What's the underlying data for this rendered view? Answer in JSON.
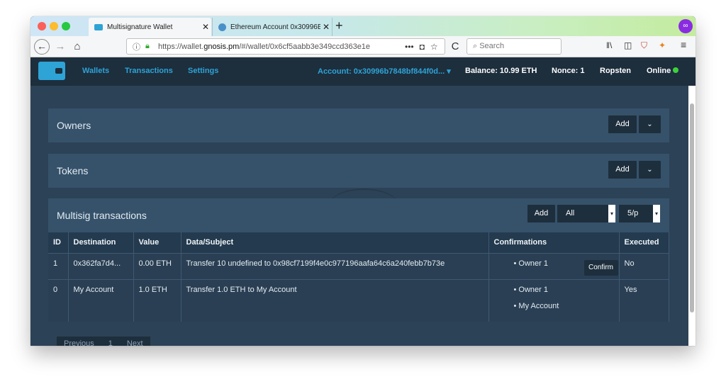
{
  "browser": {
    "tabs": [
      {
        "title": "Multisignature Wallet",
        "close": "✕"
      },
      {
        "title": "Ethereum Account 0x30996B7€",
        "close": "✕"
      }
    ],
    "new_tab": "+",
    "url_prefix": "https://wallet.",
    "url_domain": "gnosis.pm",
    "url_rest": "/#/wallet/0x6cf5aabb3e349ccd363e1e",
    "search_placeholder": "Search",
    "toolbar_icons": [
      "library-icon",
      "sidebar-icon",
      "ublock-icon",
      "metamask-icon",
      "menu-icon"
    ]
  },
  "app": {
    "nav": {
      "wallets": "Wallets",
      "transactions": "Transactions",
      "settings": "Settings"
    },
    "account": "Account: 0x30996b7848bf844f0d...",
    "account_caret": "▾",
    "balance": "Balance: 10.99 ETH",
    "nonce": "Nonce: 1",
    "network": "Ropsten",
    "status": "Online",
    "colors": {
      "accent": "#2ea3d6",
      "online": "#3cd23c",
      "panel": "#36526a",
      "background": "#2c4256",
      "navbar": "#1d2e3d"
    }
  },
  "panels": {
    "owners": {
      "title": "Owners",
      "add": "Add",
      "toggle": "⌄"
    },
    "tokens": {
      "title": "Tokens",
      "add": "Add",
      "toggle": "⌄"
    },
    "multisig": {
      "title": "Multisig transactions",
      "add": "Add",
      "filter": "All",
      "page_size": "5/p",
      "columns": {
        "id": "ID",
        "destination": "Destination",
        "value": "Value",
        "data": "Data/Subject",
        "confirmations": "Confirmations",
        "executed": "Executed"
      },
      "rows": [
        {
          "id": "1",
          "destination": "0x362fa7d4...",
          "value": "0.00 ETH",
          "data": "Transfer 10 undefined to 0x98cf7199f4e0c977196aafa64c6a240febb7b73e",
          "confirmations": [
            "Owner 1"
          ],
          "confirm_button": "Confirm",
          "executed": "No"
        },
        {
          "id": "0",
          "destination": "My Account",
          "value": "1.0 ETH",
          "data": "Transfer 1.0 ETH to My Account",
          "confirmations": [
            "Owner 1",
            "My Account"
          ],
          "executed": "Yes"
        }
      ],
      "pagination": {
        "previous": "Previous",
        "page": "1",
        "next": "Next"
      }
    }
  }
}
